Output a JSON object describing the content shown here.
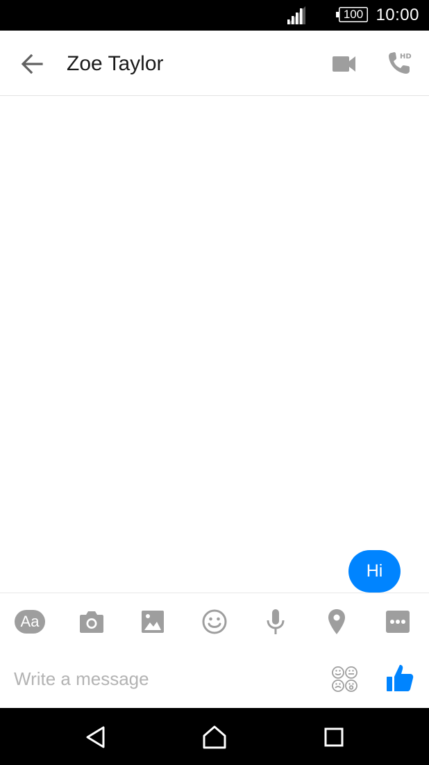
{
  "status_bar": {
    "battery_level": "100",
    "time": "10:00"
  },
  "header": {
    "contact_name": "Zoe Taylor",
    "icons": [
      "arrow-left-icon",
      "video-camera-icon",
      "phone-hd-icon"
    ]
  },
  "conversation": {
    "messages": [
      {
        "text": "Hi",
        "direction": "outgoing"
      }
    ]
  },
  "toolbar": {
    "icons": [
      "text-format-icon",
      "camera-icon",
      "image-icon",
      "emoji-icon",
      "microphone-icon",
      "location-pin-icon",
      "more-icon"
    ],
    "text_format_label": "Aa"
  },
  "composer": {
    "placeholder": "Write a message",
    "value": "",
    "icons": [
      "stickers-icon",
      "thumbs-up-icon"
    ]
  },
  "nav_bar": {
    "icons": [
      "nav-back-icon",
      "nav-home-icon",
      "nav-recents-icon"
    ]
  },
  "colors": {
    "accent": "#0084ff",
    "icon_gray": "#9e9e9e",
    "status_bar_bg": "#000000",
    "nav_bar_bg": "#000000"
  }
}
